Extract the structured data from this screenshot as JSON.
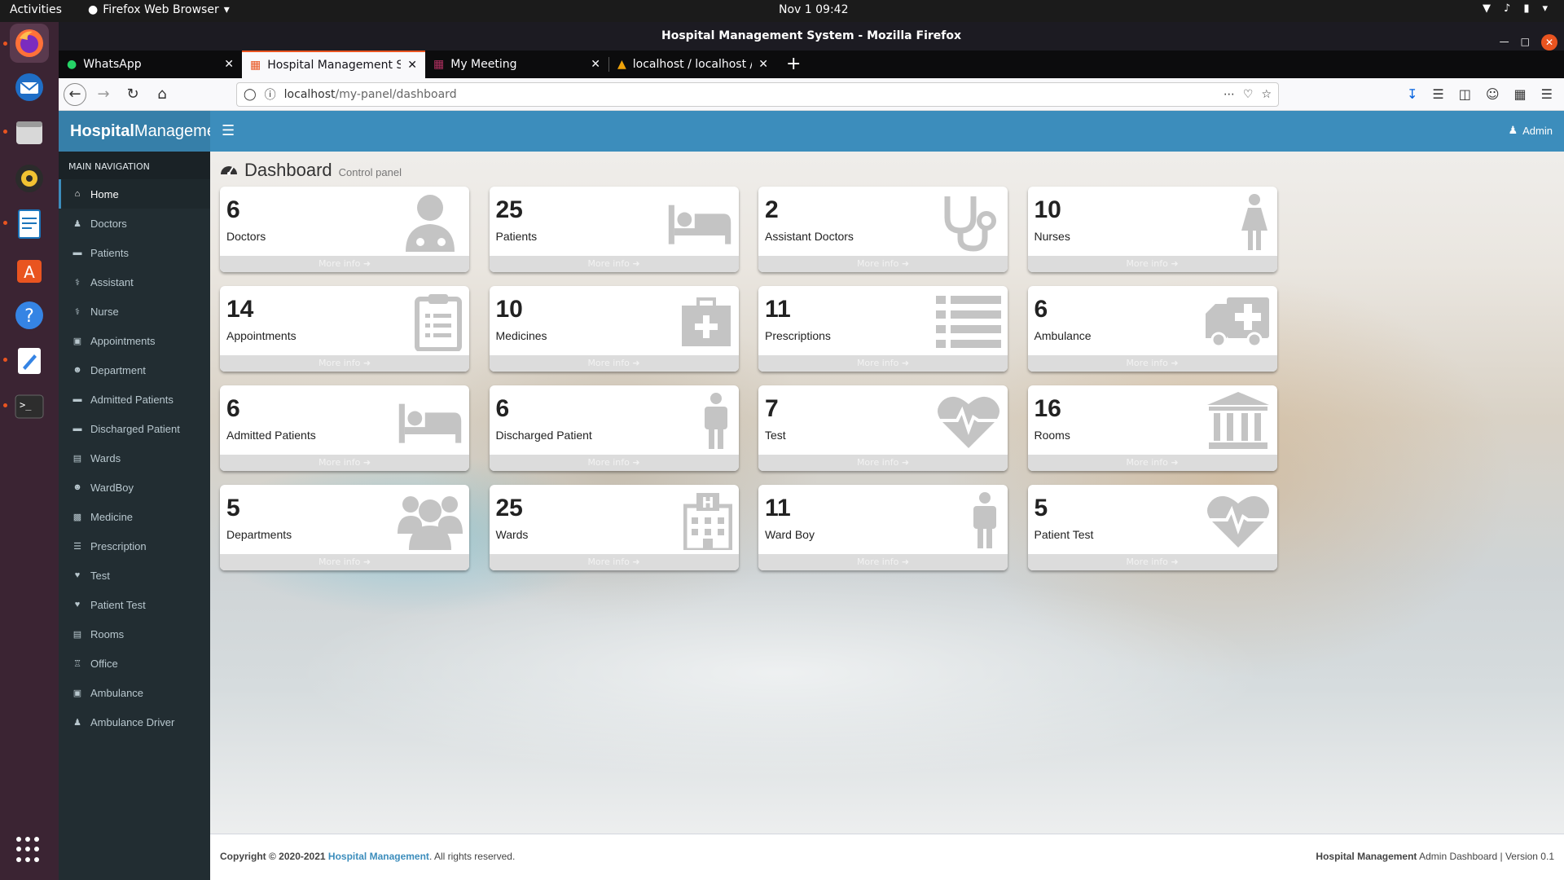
{
  "system": {
    "activities": "Activities",
    "app_menu": "Firefox Web Browser",
    "clock": "Nov 1  09:42"
  },
  "window": {
    "title": "Hospital Management System - Mozilla Firefox"
  },
  "tabs": [
    {
      "title": "WhatsApp",
      "icon": "whatsapp-icon"
    },
    {
      "title": "Hospital Management Sy",
      "icon": "app-icon",
      "active": true
    },
    {
      "title": "My Meeting",
      "icon": "meeting-icon"
    },
    {
      "title": "localhost / localhost / Ho",
      "icon": "phpmyadmin-icon"
    }
  ],
  "urlbar": {
    "host": "localhost",
    "path": "/my-panel/dashboard"
  },
  "app": {
    "brand_bold": "Hospital",
    "brand_rest": "Management",
    "nav_header": "MAIN NAVIGATION",
    "user": "Admin",
    "page_title": "Dashboard",
    "page_subtitle": "Control panel",
    "more_info": "More info ➜"
  },
  "menu": [
    {
      "label": "Home",
      "icon": "⌂",
      "active": true
    },
    {
      "label": "Doctors",
      "icon": "♟"
    },
    {
      "label": "Patients",
      "icon": "▬"
    },
    {
      "label": "Assistant",
      "icon": "⚕"
    },
    {
      "label": "Nurse",
      "icon": "⚕"
    },
    {
      "label": "Appointments",
      "icon": "▣"
    },
    {
      "label": "Department",
      "icon": "☻"
    },
    {
      "label": "Admitted Patients",
      "icon": "▬"
    },
    {
      "label": "Discharged Patient",
      "icon": "▬"
    },
    {
      "label": "Wards",
      "icon": "▤"
    },
    {
      "label": "WardBoy",
      "icon": "☻"
    },
    {
      "label": "Medicine",
      "icon": "▩"
    },
    {
      "label": "Prescription",
      "icon": "☰"
    },
    {
      "label": "Test",
      "icon": "♥"
    },
    {
      "label": "Patient Test",
      "icon": "♥"
    },
    {
      "label": "Rooms",
      "icon": "▤"
    },
    {
      "label": "Office",
      "icon": "♖"
    },
    {
      "label": "Ambulance",
      "icon": "▣"
    },
    {
      "label": "Ambulance Driver",
      "icon": "♟"
    }
  ],
  "cards": [
    {
      "count": "6",
      "label": "Doctors",
      "icon": "user-md-icon"
    },
    {
      "count": "25",
      "label": "Patients",
      "icon": "bed-icon"
    },
    {
      "count": "2",
      "label": "Assistant Doctors",
      "icon": "stethoscope-icon"
    },
    {
      "count": "10",
      "label": "Nurses",
      "icon": "female-icon"
    },
    {
      "count": "14",
      "label": "Appointments",
      "icon": "clipboard-icon"
    },
    {
      "count": "10",
      "label": "Medicines",
      "icon": "medkit-icon"
    },
    {
      "count": "11",
      "label": "Prescriptions",
      "icon": "list-icon"
    },
    {
      "count": "6",
      "label": "Ambulance",
      "icon": "ambulance-icon"
    },
    {
      "count": "6",
      "label": "Admitted Patients",
      "icon": "bed-icon"
    },
    {
      "count": "6",
      "label": "Discharged Patient",
      "icon": "male-icon"
    },
    {
      "count": "7",
      "label": "Test",
      "icon": "heartbeat-icon"
    },
    {
      "count": "16",
      "label": "Rooms",
      "icon": "institution-icon"
    },
    {
      "count": "5",
      "label": "Departments",
      "icon": "users-icon"
    },
    {
      "count": "25",
      "label": "Wards",
      "icon": "hospital-icon"
    },
    {
      "count": "11",
      "label": "Ward Boy",
      "icon": "male-icon"
    },
    {
      "count": "5",
      "label": "Patient Test",
      "icon": "heartbeat-icon"
    }
  ],
  "footer": {
    "copyright": "Copyright © 2020-2021",
    "link": "Hospital Management",
    "rights": ". All rights reserved.",
    "right_bold": "Hospital Management",
    "right_rest": "Admin Dashboard | Version 0.1"
  },
  "colors": {
    "header": "#3c8dbc",
    "brand": "#367fa9",
    "sidebar": "#222d32",
    "accent_tab": "#e95420"
  }
}
